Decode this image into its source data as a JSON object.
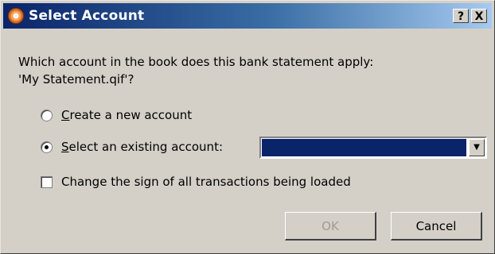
{
  "window": {
    "title": "Select Account",
    "help_label": "?",
    "close_label": "X"
  },
  "prompt": {
    "line1": "Which account in the book does this bank statement apply:",
    "line2": "'My Statement.qif'?"
  },
  "options": {
    "create_new": {
      "accel": "C",
      "rest": "reate a new account",
      "selected": false
    },
    "select_existing": {
      "accel": "S",
      "rest": "elect an existing account:",
      "selected": true
    },
    "change_sign": {
      "label": "Change the sign of all transactions being loaded",
      "checked": false
    }
  },
  "account_combo": {
    "selected_value": "",
    "arrow": "▼"
  },
  "buttons": {
    "ok_label": "OK",
    "ok_enabled": false,
    "cancel_label": "Cancel"
  },
  "colors": {
    "title_bar": "#0a246a",
    "dialog_bg": "#d4d0c8",
    "selection": "#0a246a",
    "disabled_text": "#a09c94"
  }
}
